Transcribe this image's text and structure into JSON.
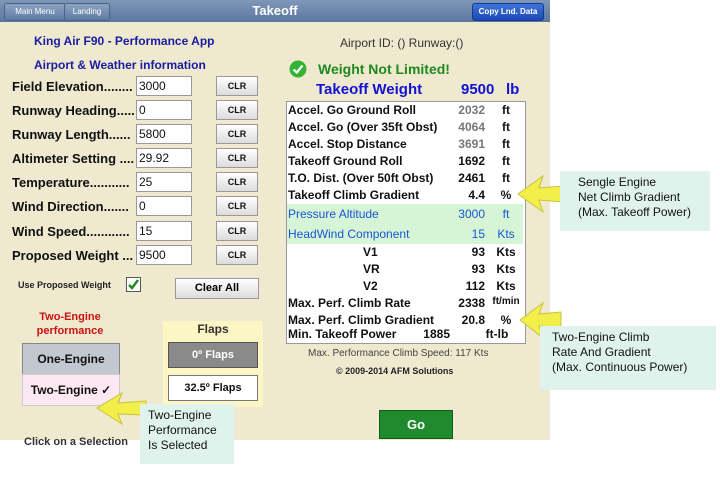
{
  "topbar": {
    "main_menu": "Main Menu",
    "landing": "Landing",
    "title": "Takeoff",
    "copy": "Copy Lnd. Data"
  },
  "app_title": "King Air F90 - Performance App",
  "section_title": "Airport & Weather information",
  "airport_id": "Airport ID: () Runway:()",
  "fields": [
    {
      "label": "Field Elevation........",
      "value": "3000"
    },
    {
      "label": "Runway Heading.....",
      "value": "0"
    },
    {
      "label": "Runway Length......",
      "value": "5800"
    },
    {
      "label": "Altimeter Setting ....",
      "value": "29.92"
    },
    {
      "label": "Temperature...........",
      "value": "25"
    },
    {
      "label": "Wind Direction.......",
      "value": "0"
    },
    {
      "label": "Wind Speed............",
      "value": "15"
    },
    {
      "label": "Proposed Weight ...",
      "value": "9500"
    }
  ],
  "clr_label": "CLR",
  "use_proposed": "Use Proposed Weight",
  "clear_all": "Clear All",
  "perf_title": "Two-Engine performance",
  "one_engine": "One-Engine",
  "two_engine": "Two-Engine ✓",
  "flaps": {
    "title": "Flaps",
    "zero": "0º Flaps",
    "thirtytwo": "32.5º Flaps"
  },
  "status": {
    "icon": "check-circle",
    "text": "Weight Not Limited!"
  },
  "takeoff_weight": {
    "label": "Takeoff Weight",
    "value": "9500",
    "unit": "lb"
  },
  "results": [
    {
      "label": "Accel. Go Ground Roll",
      "value": "2032",
      "unit": "ft"
    },
    {
      "label": "Accel. Go (Over 35ft Obst)",
      "value": "4064",
      "unit": "ft"
    },
    {
      "label": "Accel. Stop Distance",
      "value": "3691",
      "unit": "ft"
    },
    {
      "label": "Takeoff Ground Roll",
      "value": "1692",
      "unit": "ft"
    },
    {
      "label": "T.O. Dist. (Over 50ft Obst)",
      "value": "2461",
      "unit": "ft"
    },
    {
      "label": "Takeoff Climb Gradient",
      "value": "4.4",
      "unit": "%"
    },
    {
      "label": "Pressure Altitude",
      "value": "3000",
      "unit": "ft"
    },
    {
      "label": "HeadWind Component",
      "value": "15",
      "unit": "Kts"
    },
    {
      "label": "V1",
      "value": "93",
      "unit": "Kts"
    },
    {
      "label": "VR",
      "value": "93",
      "unit": "Kts"
    },
    {
      "label": "V2",
      "value": "112",
      "unit": "Kts"
    },
    {
      "label": "Max. Perf. Climb Rate",
      "value": "2338",
      "unit": "ft/min"
    },
    {
      "label": "Max. Perf. Climb Gradient",
      "value": "20.8",
      "unit": "%"
    },
    {
      "label": "Min. Takeoff Power",
      "value": "1885",
      "unit": "ft-lb"
    }
  ],
  "climb_speed": "Max. Performance Climb Speed: 117 Kts",
  "copyright": "© 2009-2014 AFM Solutions",
  "go": "Go",
  "cut_text": "Click on a Selection",
  "callouts": {
    "single": [
      "Sengle Engine",
      "Net Climb Gradient",
      "(Max. Takeoff Power)"
    ],
    "two": [
      "Two-Engine Climb",
      "Rate And Gradient",
      "(Max. Continuous Power)"
    ],
    "selected": [
      "Two-Engine",
      "Performance",
      "Is Selected"
    ]
  },
  "colors": {
    "topbar": "#6a82ab",
    "app_bg": "#efe9cf",
    "blue_text": "#1a1ca0",
    "green": "#1e8a1e",
    "highlight": "#d6f5d6",
    "go_button": "#1f8a2e",
    "callout": "#dff3ec",
    "arrow": "#f2ee4a"
  }
}
